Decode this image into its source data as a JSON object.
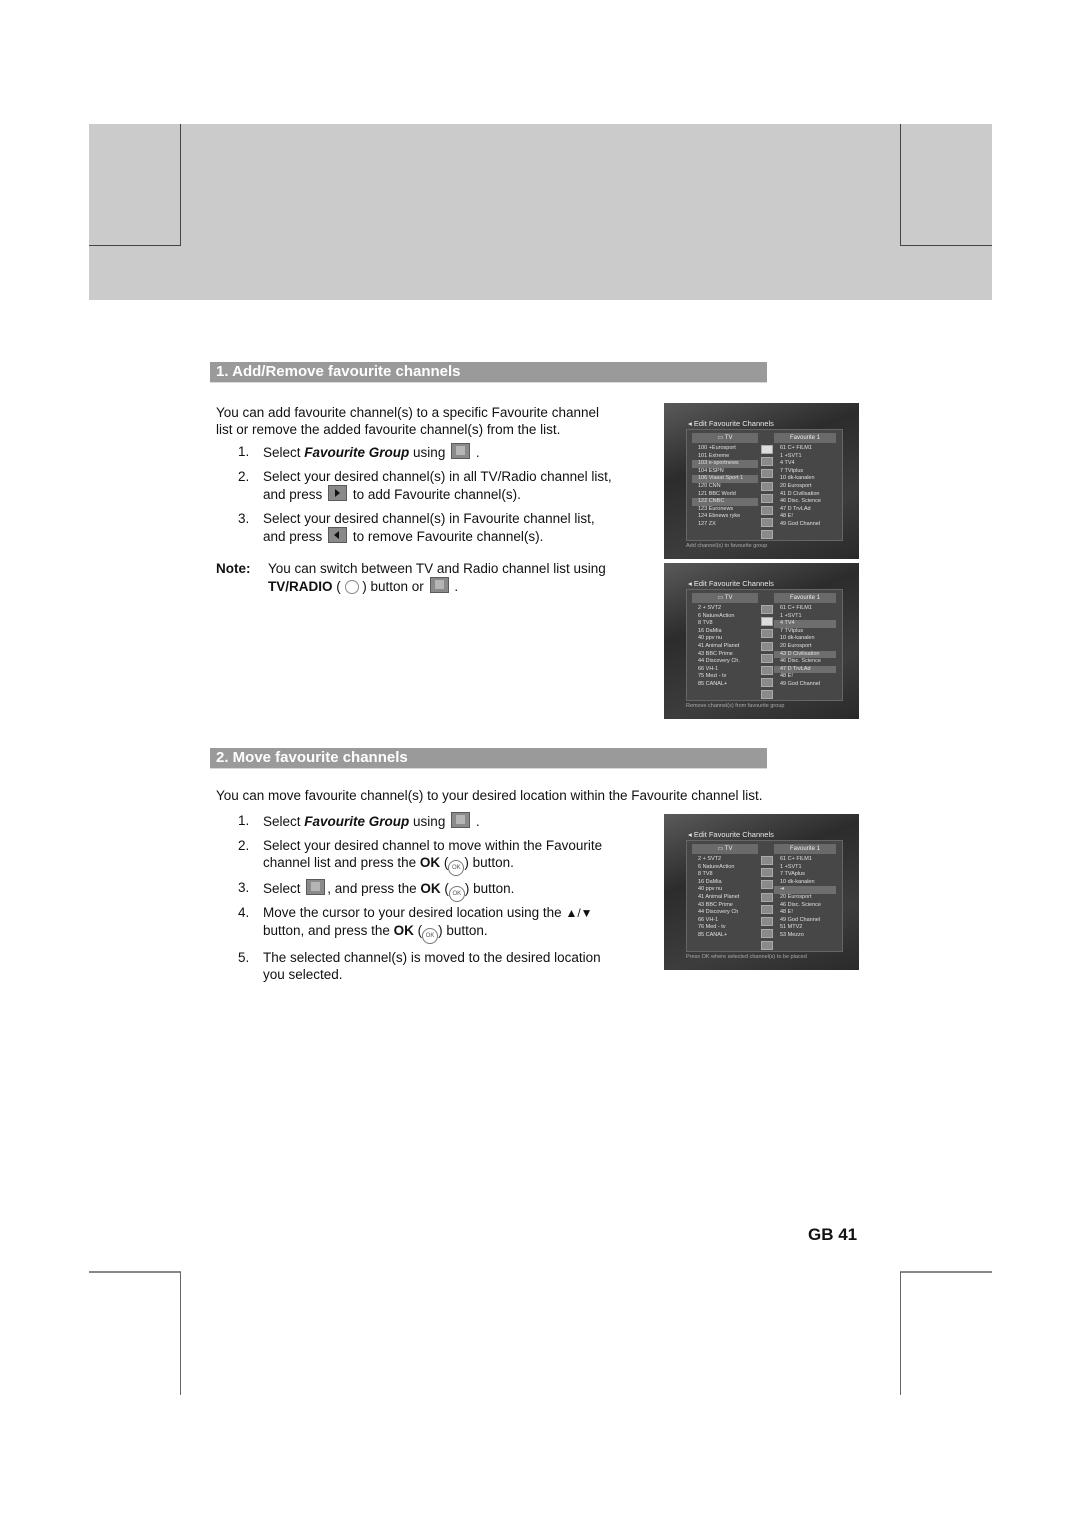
{
  "section1": {
    "heading": "1. Add/Remove favourite channels",
    "intro_line1": "You can add favourite channel(s) to a specific Favourite channel",
    "intro_line2": "list or remove the added favourite channel(s) from the list.",
    "steps": [
      {
        "num": "1.",
        "pre": "Select ",
        "em": "Favourite Group",
        "post": " using",
        "icon": "favourite-group-icon",
        "end": "."
      },
      {
        "num": "2.",
        "line1": "Select your desired channel(s) in all TV/Radio channel list,",
        "line2_pre": "and press",
        "icon": "add-arrow-icon",
        "line2_post": "to add Favourite channel(s)."
      },
      {
        "num": "3.",
        "line1": "Select your desired channel(s) in Favourite channel list,",
        "line2_pre": "and press",
        "icon": "remove-arrow-icon",
        "line2_post": "to remove Favourite channel(s)."
      }
    ],
    "note_label": "Note:",
    "note_line1": "You can switch between TV and Radio channel list using",
    "note_bold": "TV/RADIO",
    "note_mid": "button or",
    "note_end": "."
  },
  "section2": {
    "heading": "2. Move favourite channels",
    "intro": "You can move favourite channel(s) to your desired location within the Favourite channel list.",
    "steps": [
      {
        "num": "1.",
        "pre": "Select ",
        "em": "Favourite Group",
        "post": " using",
        "end": "."
      },
      {
        "num": "2.",
        "line1": "Select your desired channel to move within the Favourite",
        "line2_pre": "channel list and press the ",
        "bold": "OK",
        "line2_post": "button."
      },
      {
        "num": "3.",
        "pre": "Select",
        "mid": ", and press the ",
        "bold": "OK",
        "post": "button."
      },
      {
        "num": "4.",
        "line1": "Move the cursor to your desired location using the",
        "arrows": "▲/▼",
        "line2_pre": "button, and press the ",
        "bold": "OK",
        "line2_post": "button."
      },
      {
        "num": "5.",
        "line1": "The selected channel(s) is moved to the desired location",
        "line2": "you selected."
      }
    ]
  },
  "ok_glyph": "OK",
  "screenshots": [
    {
      "title": "◂ Edit Favourite Channels",
      "left_header": "TV",
      "right_header": "Favourite 1",
      "left_list": [
        "100 +Eurosport",
        "101 Extreme",
        "103 e-sportnews",
        "104 ESPN",
        "106 Viasat Sport 1",
        "120 CNN",
        "121 BBC World",
        "122 CNBC",
        "123 Euronews",
        "124 Ebnews ryke",
        "127 ZX"
      ],
      "left_highlight": [
        2,
        4,
        7
      ],
      "right_list": [
        "61 C+ FILM1",
        "1 +SVT1",
        "4 TV4",
        "7 TVtplus",
        "10 dk-kanalen",
        "20 Eurosport",
        "41 D Civilisation",
        "46 Disc. Science",
        "47 D TrvLAd",
        "48 E!",
        "49 God Channel"
      ],
      "right_highlight": [],
      "selected_button": 0,
      "hint": "Add channel(s) to favourite group"
    },
    {
      "title": "◂ Edit Favourite Channels",
      "left_header": "TV",
      "right_header": "Favourite 1",
      "left_list": [
        "2 + SVT2",
        "6 NatureAction",
        "8 TV8",
        "16 DaMia",
        "40 ppv nu",
        "41 Animal Planet",
        "43 BBC Prime",
        "44 Discovery Ch.",
        "66 VH-1",
        "75 Mezi - tv",
        "85 CANAL+"
      ],
      "left_highlight": [],
      "right_list": [
        "61 C+ FILM1",
        "1 +SVT1",
        "4 TV4",
        "7 TVtplus",
        "10 dk-kanalen",
        "20 Eurosport",
        "43 D Civilisation",
        "46 Disc. Science",
        "47 D TrvLAd",
        "48 E!",
        "49 God Channel"
      ],
      "right_highlight": [
        2,
        6,
        8
      ],
      "selected_button": 1,
      "hint": "Remove channel(s) from favourite group"
    },
    {
      "title": "◂ Edit Favourite Channels",
      "left_header": "TV",
      "right_header": "Favourite 1",
      "left_list": [
        "2 + SVT2",
        "6 NatureAction",
        "8 TV8",
        "16 DaMia",
        "40 ppv nu",
        "41 Animal Planet",
        "43 BBC Prime",
        "44 Discovery Ch",
        "66 VH-1",
        "76 Med - tv",
        "85 CANAL+"
      ],
      "left_highlight": [],
      "right_list": [
        "61 C+ FILM1",
        "1 +SVT1",
        "7 TVAplus",
        "10 dk-kanalen",
        "➔",
        "20 Eurosport",
        "46 Disc. Science",
        "48 E!",
        "49 God Channel",
        "51 MTV2",
        "53 Mezzo"
      ],
      "right_highlight": [
        4
      ],
      "selected_button": -1,
      "hint": "Press OK where selected channel(s) to be placed"
    }
  ],
  "page_number": "GB 41"
}
